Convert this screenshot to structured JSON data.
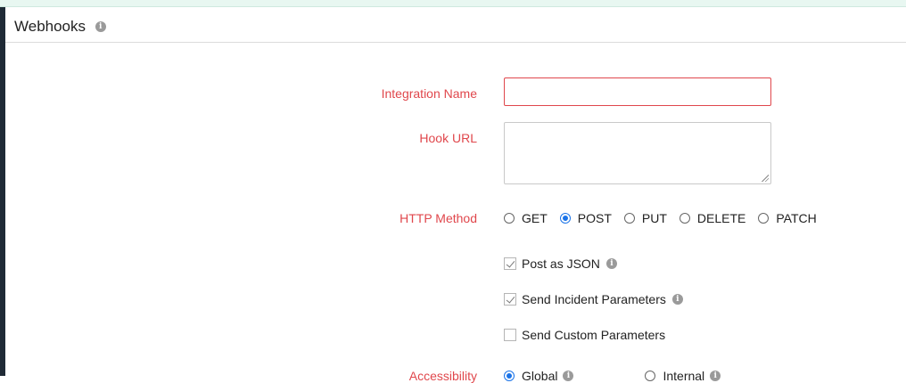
{
  "header": {
    "title": "Webhooks",
    "info_icon": "info-icon"
  },
  "form": {
    "integration_name": {
      "label": "Integration Name",
      "value": "",
      "placeholder": ""
    },
    "hook_url": {
      "label": "Hook URL",
      "value": "",
      "placeholder": ""
    },
    "http_method": {
      "label": "HTTP Method",
      "options": [
        "GET",
        "POST",
        "PUT",
        "DELETE",
        "PATCH"
      ],
      "selected": "POST"
    },
    "post_as_json": {
      "label": "Post as JSON",
      "checked": true
    },
    "send_incident_parameters": {
      "label": "Send Incident Parameters",
      "checked": true
    },
    "send_custom_parameters": {
      "label": "Send Custom Parameters",
      "checked": false
    },
    "accessibility": {
      "label": "Accessibility",
      "options": [
        "Global",
        "Internal"
      ],
      "selected": "Global"
    }
  },
  "colors": {
    "label_red": "#e0474c",
    "accent_blue": "#1a73e8",
    "left_bar": "#1f2a36"
  }
}
